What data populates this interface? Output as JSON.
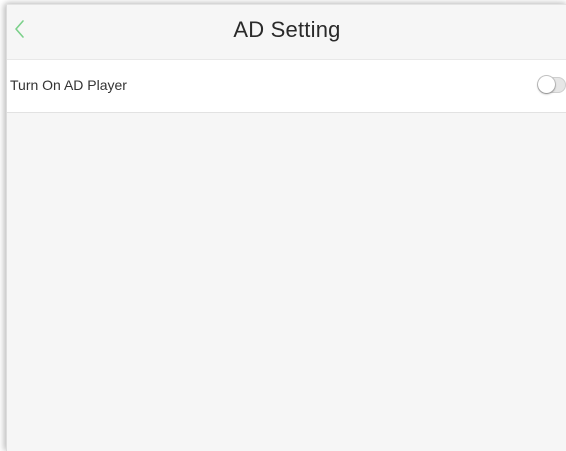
{
  "header": {
    "title": "AD Setting",
    "back_icon": "chevron-left-icon",
    "accent_color": "#7bd08a"
  },
  "settings": {
    "ad_player": {
      "label": "Turn On AD Player",
      "enabled": false
    }
  }
}
